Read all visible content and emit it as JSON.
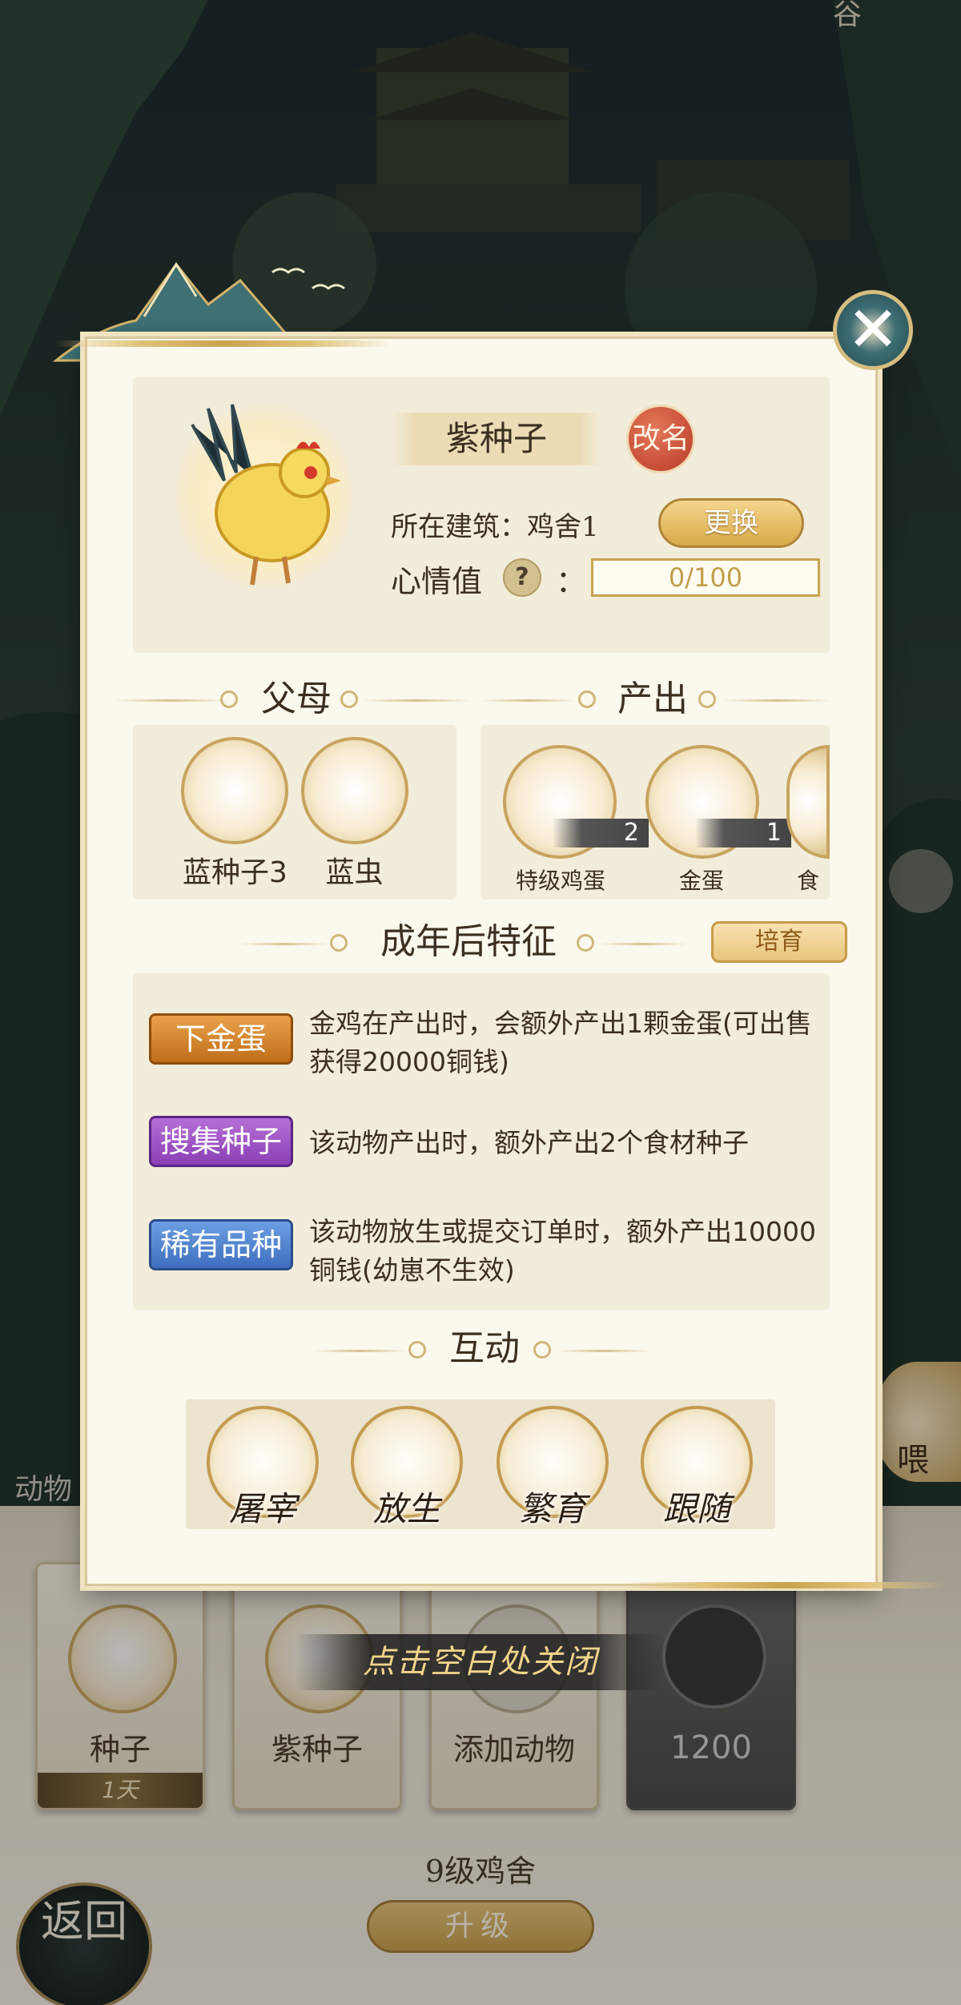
{
  "modal": {
    "animal_name": "紫种子",
    "rename_label": "改名",
    "location_text": "所在建筑：鸡舍1",
    "change_label": "更换",
    "mood_label": "心情值",
    "mood_help": "?",
    "mood_colon": "：",
    "mood_value": "0/100",
    "close_glyph": "✕"
  },
  "parents": {
    "title": "父母",
    "items": [
      {
        "name": "蓝种子3"
      },
      {
        "name": "蓝虫"
      }
    ]
  },
  "output": {
    "title": "产出",
    "items": [
      {
        "name": "特级鸡蛋",
        "count": "2"
      },
      {
        "name": "金蛋",
        "count": "1"
      },
      {
        "name": "食"
      }
    ]
  },
  "traits": {
    "title": "成年后特征",
    "breed_label": "培育",
    "items": [
      {
        "tag": "下金蛋",
        "desc": "金鸡在产出时，会额外产出1颗金蛋(可出售获得20000铜钱)"
      },
      {
        "tag": "搜集种子",
        "desc": "该动物产出时，额外产出2个食材种子"
      },
      {
        "tag": "稀有品种",
        "desc": "该动物放生或提交订单时，额外产出10000铜钱(幼崽不生效)"
      }
    ]
  },
  "interact": {
    "title": "互动",
    "actions": [
      {
        "label": "屠宰",
        "icon": "cleaver-icon"
      },
      {
        "label": "放生",
        "icon": "bird-icon"
      },
      {
        "label": "繁育",
        "icon": "hearts-icon"
      },
      {
        "label": "跟随",
        "icon": "pawprint-icon"
      }
    ]
  },
  "close_hint": "点击空白处关闭",
  "background": {
    "side_tab": "动物",
    "feed_label": "喂",
    "cards": [
      {
        "name": "种子",
        "timer": "1天"
      },
      {
        "name": "紫种子"
      },
      {
        "name": "添加动物"
      },
      {
        "price": "1200"
      }
    ],
    "coop_title": "9级鸡舍",
    "upgrade_label": "升级",
    "back_label": "返回",
    "top_glyph": "谷"
  },
  "colors": {
    "panel_bg": "#fbf8ee",
    "accent_gold": "#c9a34d",
    "tag_gold": "#c06d18",
    "tag_purple": "#8a3fb4",
    "tag_blue": "#3e6fbf",
    "rename_red": "#b83a26"
  }
}
